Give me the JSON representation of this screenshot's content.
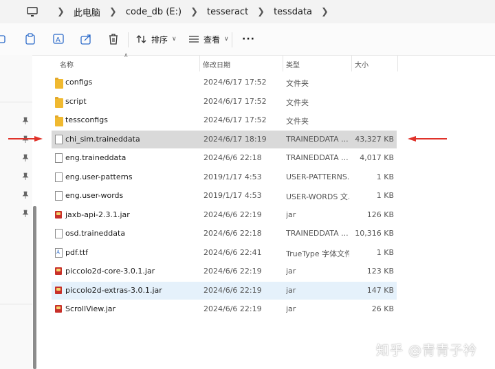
{
  "breadcrumb": [
    "此电脑",
    "code_db (E:)",
    "tesseract",
    "tessdata"
  ],
  "toolbar": {
    "sort_label": "排序",
    "view_label": "查看",
    "more_label": "···"
  },
  "columns": {
    "name": "名称",
    "date": "修改日期",
    "type": "类型",
    "size": "大小"
  },
  "files": [
    {
      "name": "configs",
      "date": "2024/6/17 17:52",
      "type": "文件夹",
      "size": "",
      "icon": "folder-icon"
    },
    {
      "name": "script",
      "date": "2024/6/17 17:52",
      "type": "文件夹",
      "size": "",
      "icon": "folder-icon"
    },
    {
      "name": "tessconfigs",
      "date": "2024/6/17 17:52",
      "type": "文件夹",
      "size": "",
      "icon": "folder-icon"
    },
    {
      "name": "chi_sim.traineddata",
      "date": "2024/6/17 18:19",
      "type": "TRAINEDDATA ...",
      "size": "43,327 KB",
      "icon": "file-icon"
    },
    {
      "name": "eng.traineddata",
      "date": "2024/6/6 22:18",
      "type": "TRAINEDDATA ...",
      "size": "4,017 KB",
      "icon": "file-icon"
    },
    {
      "name": "eng.user-patterns",
      "date": "2019/1/17 4:53",
      "type": "USER-PATTERNS...",
      "size": "1 KB",
      "icon": "file-icon"
    },
    {
      "name": "eng.user-words",
      "date": "2019/1/17 4:53",
      "type": "USER-WORDS 文...",
      "size": "1 KB",
      "icon": "file-icon"
    },
    {
      "name": "jaxb-api-2.3.1.jar",
      "date": "2024/6/6 22:19",
      "type": "jar",
      "size": "126 KB",
      "icon": "jar-icon"
    },
    {
      "name": "osd.traineddata",
      "date": "2024/6/6 22:18",
      "type": "TRAINEDDATA ...",
      "size": "10,316 KB",
      "icon": "file-icon"
    },
    {
      "name": "pdf.ttf",
      "date": "2024/6/6 22:41",
      "type": "TrueType 字体文件",
      "size": "1 KB",
      "icon": "font-file-icon"
    },
    {
      "name": "piccolo2d-core-3.0.1.jar",
      "date": "2024/6/6 22:19",
      "type": "jar",
      "size": "123 KB",
      "icon": "jar-icon"
    },
    {
      "name": "piccolo2d-extras-3.0.1.jar",
      "date": "2024/6/6 22:19",
      "type": "jar",
      "size": "147 KB",
      "icon": "jar-icon"
    },
    {
      "name": "ScrollView.jar",
      "date": "2024/6/6 22:19",
      "type": "jar",
      "size": "26 KB",
      "icon": "jar-icon"
    }
  ],
  "selected_row": "chi_sim.traineddata",
  "hovered_row": "piccolo2d-extras-3.0.1.jar",
  "watermark": "知乎 @青青子衿",
  "colors": {
    "arrow": "#e0322a",
    "folder": "#f0b930",
    "selection": "#d9d9d9",
    "hover": "#e5f1fb"
  }
}
